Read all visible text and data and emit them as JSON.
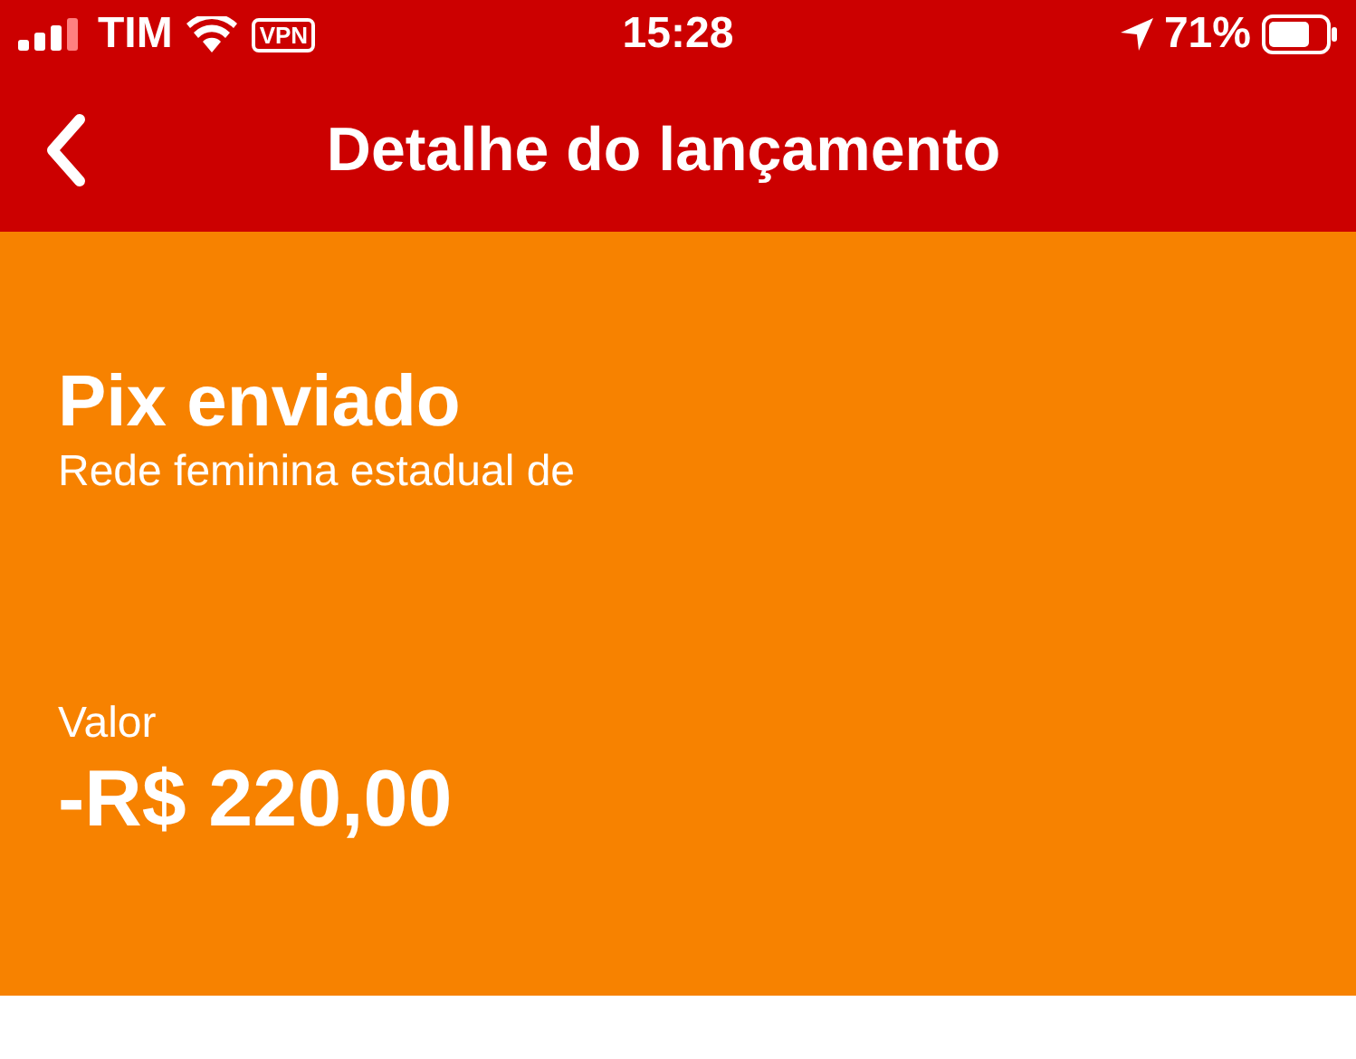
{
  "status_bar": {
    "carrier": "TIM",
    "vpn": "VPN",
    "time": "15:28",
    "battery": "71%"
  },
  "nav_bar": {
    "title": "Detalhe do lançamento"
  },
  "transaction": {
    "title": "Pix enviado",
    "description": "Rede feminina estadual de",
    "amount_label": "Valor",
    "amount": "-R$ 220,00"
  }
}
